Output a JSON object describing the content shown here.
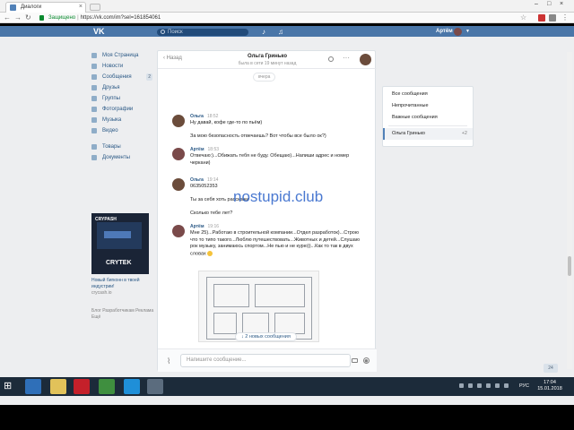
{
  "browser": {
    "tab_title": "Диалоги",
    "url_secure_label": "Защищено",
    "url": "https://vk.com/im?sel=161854061"
  },
  "header": {
    "logo": "VK",
    "search_placeholder": "Поиск",
    "user_name": "Артём"
  },
  "sidebar": {
    "items": [
      {
        "label": "Моя Страница"
      },
      {
        "label": "Новости"
      },
      {
        "label": "Сообщения",
        "count": "2"
      },
      {
        "label": "Друзья"
      },
      {
        "label": "Группы"
      },
      {
        "label": "Фотографии"
      },
      {
        "label": "Музыка"
      },
      {
        "label": "Видео"
      },
      {
        "label": "Товары"
      },
      {
        "label": "Документы"
      }
    ],
    "ad": {
      "brand_top": "CRYPASH",
      "brand_bottom": "CRYTEK",
      "caption": "Новый бигконн в твоей индустрии!",
      "domain": "cryсash.io"
    },
    "footer": "Блог  Разработчикам  Реклама  Ещё"
  },
  "chat": {
    "back_label": "Назад",
    "name": "Ольга Гринько",
    "status": "была в сети 19 минут назад",
    "date_pill": "вчера",
    "messages": [
      {
        "author": "Ольга",
        "time": "18:52",
        "text": "Ну давай, кофе где-то по пьём)\n\nЗа мою безопасность отвечаешь? Вот чтобы все было ок?)"
      },
      {
        "author": "Артём",
        "time": "18:53",
        "text": "Отвечаю:)...Обижать тебя не буду. Обещаю)...Напиши адрес и номер черкани)"
      },
      {
        "author": "Ольга",
        "time": "19:14",
        "text": "0635052353"
      },
      {
        "author": "",
        "time": "",
        "text": "Ты за себя хоть расскажи\n\nСколько тебе лет?"
      },
      {
        "author": "Артём",
        "time": "19:16",
        "text": "Мне 25)...Работаю в строительной компании...Отдел разработок)...Строю что то типо такого...Люблю путешествовать...Животных и детей...Слушаю рок музыку, занимаюсь спортом...Не пью и не курю))...Как то так в двух словах"
      }
    ],
    "new_messages": "↓ 2 новых сообщения",
    "composer_placeholder": "Напишите сообщение..."
  },
  "right_panel": {
    "items": [
      "Все сообщения",
      "Непрочитанные",
      "Важные сообщения"
    ],
    "active": {
      "label": "Ольга Гринько",
      "count": "+2"
    }
  },
  "watermark": "nostupid.club",
  "mini_widget": "24",
  "taskbar": {
    "lang": "РУС",
    "time": "17:04",
    "date": "15.01.2018"
  },
  "colors": {
    "vk_blue": "#4a76a8",
    "link": "#2a5885",
    "taskbar": "#1c2b3a"
  }
}
